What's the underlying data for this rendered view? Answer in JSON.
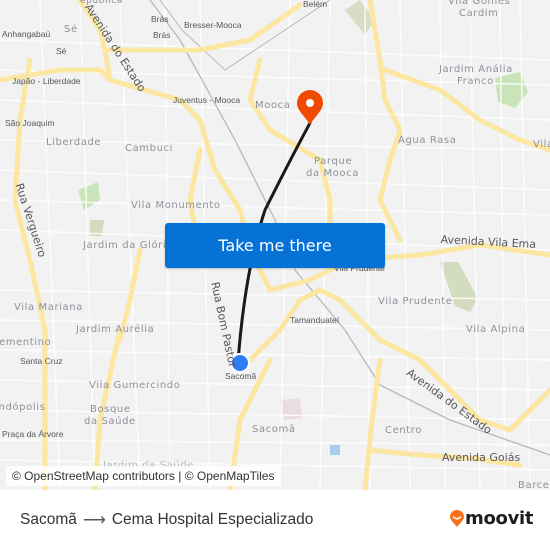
{
  "map": {
    "area_labels": [
      {
        "text": "Sé",
        "kind": "district"
      },
      {
        "text": "Anhangabaú",
        "kind": "station"
      },
      {
        "text": "Sé",
        "kind": "station"
      },
      {
        "text": "Japão - Liberdade",
        "kind": "station"
      },
      {
        "text": "São Joaquim",
        "kind": "station"
      },
      {
        "text": "Liberdade",
        "kind": "district"
      },
      {
        "text": "Cambuci",
        "kind": "district"
      },
      {
        "text": "Brás",
        "kind": "station"
      },
      {
        "text": "Brás",
        "kind": "station"
      },
      {
        "text": "Bresser-Mooca",
        "kind": "station"
      },
      {
        "text": "Belém",
        "kind": "station"
      },
      {
        "text": "Juventus - Mooca",
        "kind": "station"
      },
      {
        "text": "Mooca",
        "kind": "district"
      },
      {
        "text": "Vila Gomes Cardim",
        "kind": "district"
      },
      {
        "text": "Jardim Anália",
        "kind": "district"
      },
      {
        "text": "Franco",
        "kind": "district"
      },
      {
        "text": "Água Rasa",
        "kind": "district"
      },
      {
        "text": "Vila",
        "kind": "district"
      },
      {
        "text": "Parque",
        "kind": "district"
      },
      {
        "text": "da Mooca",
        "kind": "district"
      },
      {
        "text": "Vila Monumento",
        "kind": "district"
      },
      {
        "text": "Jardim da Glória",
        "kind": "district"
      },
      {
        "text": "Vila Prudente",
        "kind": "station"
      },
      {
        "text": "Vila Prudente",
        "kind": "district"
      },
      {
        "text": "Vila Mariana",
        "kind": "district"
      },
      {
        "text": "Jardim Aurélia",
        "kind": "district"
      },
      {
        "text": "Tamanduateí",
        "kind": "station"
      },
      {
        "text": "Vila Alpina",
        "kind": "district"
      },
      {
        "text": "Clementino",
        "kind": "district"
      },
      {
        "text": "Santa Cruz",
        "kind": "station"
      },
      {
        "text": "Sacomã",
        "kind": "station"
      },
      {
        "text": "Vila Gumercindo",
        "kind": "district"
      },
      {
        "text": "Indópolis",
        "kind": "district"
      },
      {
        "text": "Bosque",
        "kind": "district"
      },
      {
        "text": "da Saúde",
        "kind": "district"
      },
      {
        "text": "Praça da Árvore",
        "kind": "station"
      },
      {
        "text": "Sacomã",
        "kind": "district"
      },
      {
        "text": "Centro",
        "kind": "district"
      },
      {
        "text": "Jardim da Saúde",
        "kind": "district"
      },
      {
        "text": "Barcel",
        "kind": "district"
      }
    ],
    "road_labels": [
      "Avenida do Estado",
      "Rua Vergueiro",
      "Avenida Vila Ema",
      "Rua Bom Pastor",
      "Avenida do Estado",
      "Avenida Goiás"
    ],
    "origin_marker": {
      "name": "Sacomã",
      "color": "#2979ff"
    },
    "destination_marker": {
      "name": "Cema Hospital Especializado",
      "color": "#f04a00"
    },
    "route_color": "#1a1a1a"
  },
  "cta": {
    "label": "Take me there",
    "color": "#0672d6"
  },
  "attribution": "© OpenStreetMap contributors | © OpenMapTiles",
  "footer": {
    "origin": "Sacomã",
    "arrow": "⟶",
    "destination": "Cema Hospital Especializado",
    "brand": "moovit",
    "brand_color": "#f7711a"
  }
}
